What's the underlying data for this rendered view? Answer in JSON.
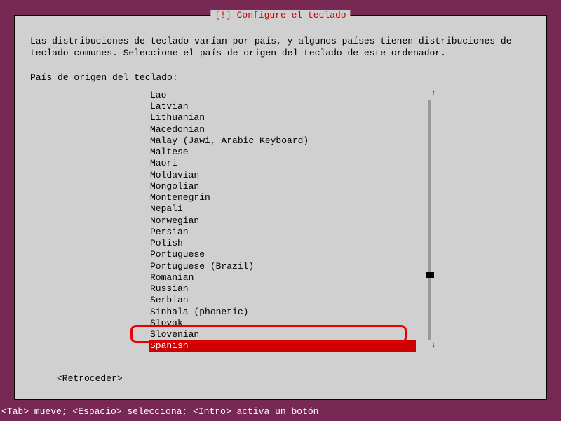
{
  "dialog": {
    "title": "[!] Configure el teclado",
    "intro": "Las distribuciones de teclado varían por país, y algunos países tienen distribuciones de\nteclado comunes. Seleccione el país de origen del teclado de este ordenador.",
    "list_label": "País de origen del teclado:",
    "items": [
      "Lao",
      "Latvian",
      "Lithuanian",
      "Macedonian",
      "Malay (Jawi, Arabic Keyboard)",
      "Maltese",
      "Maori",
      "Moldavian",
      "Mongolian",
      "Montenegrin",
      "Nepali",
      "Norwegian",
      "Persian",
      "Polish",
      "Portuguese",
      "Portuguese (Brazil)",
      "Romanian",
      "Russian",
      "Serbian",
      "Sinhala (phonetic)",
      "Slovak",
      "Slovenian",
      "Spanish"
    ],
    "selected_index": 22,
    "back_label": "<Retroceder>",
    "arrow_up": "↑",
    "arrow_down": "↓"
  },
  "status_bar": "<Tab> mueve; <Espacio> selecciona; <Intro> activa un botón"
}
